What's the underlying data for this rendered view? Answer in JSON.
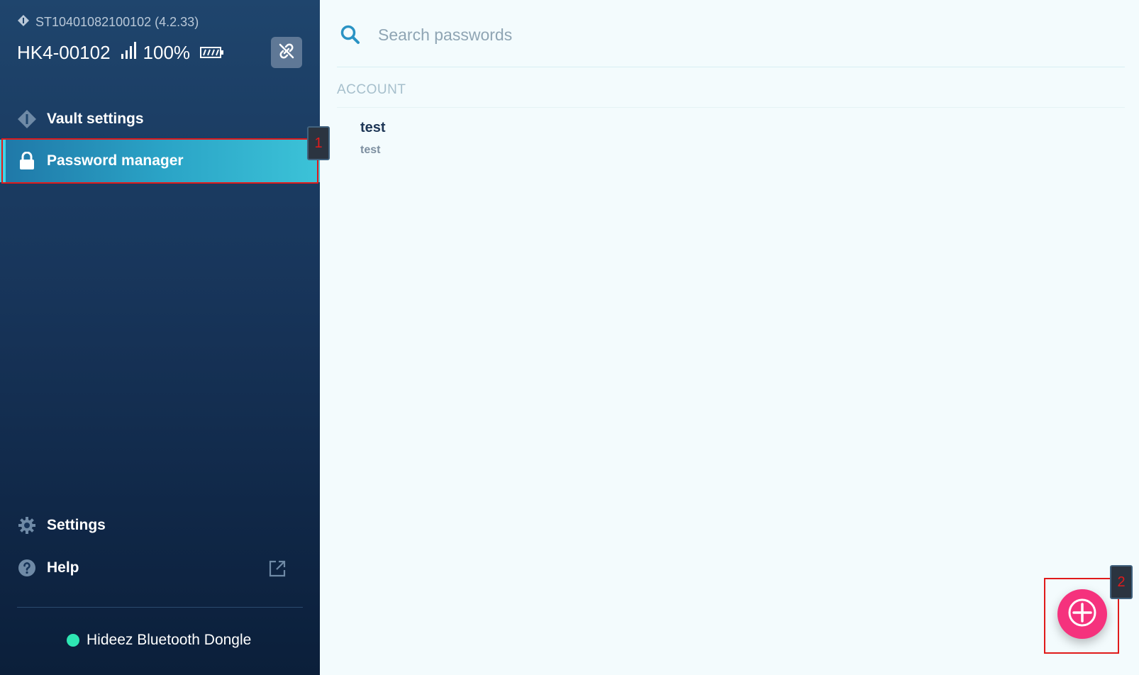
{
  "device": {
    "serial": "ST10401082100102 (4.2.33)",
    "name": "HK4-00102",
    "battery": "100%",
    "disconnect_icon": "unlink-icon"
  },
  "sidebar": {
    "items": [
      {
        "label": "Vault settings",
        "icon": "vault-icon"
      },
      {
        "label": "Password manager",
        "icon": "lock-icon",
        "active": true
      }
    ],
    "bottom_items": [
      {
        "label": "Settings",
        "icon": "gear-icon"
      },
      {
        "label": "Help",
        "icon": "help-icon"
      }
    ],
    "connection": {
      "label": "Hideez Bluetooth Dongle",
      "status_color": "#2ee6b3"
    }
  },
  "main": {
    "search": {
      "placeholder": "Search passwords",
      "value": ""
    },
    "section_header": "ACCOUNT",
    "entries": [
      {
        "title": "test",
        "subtitle": "test"
      }
    ],
    "add_button_icon": "plus-icon"
  },
  "annotations": {
    "tag1": "1",
    "tag2": "2"
  },
  "colors": {
    "accent": "#2aa3c6",
    "fab": "#f5327d",
    "sidebar_bg": "#173459"
  }
}
